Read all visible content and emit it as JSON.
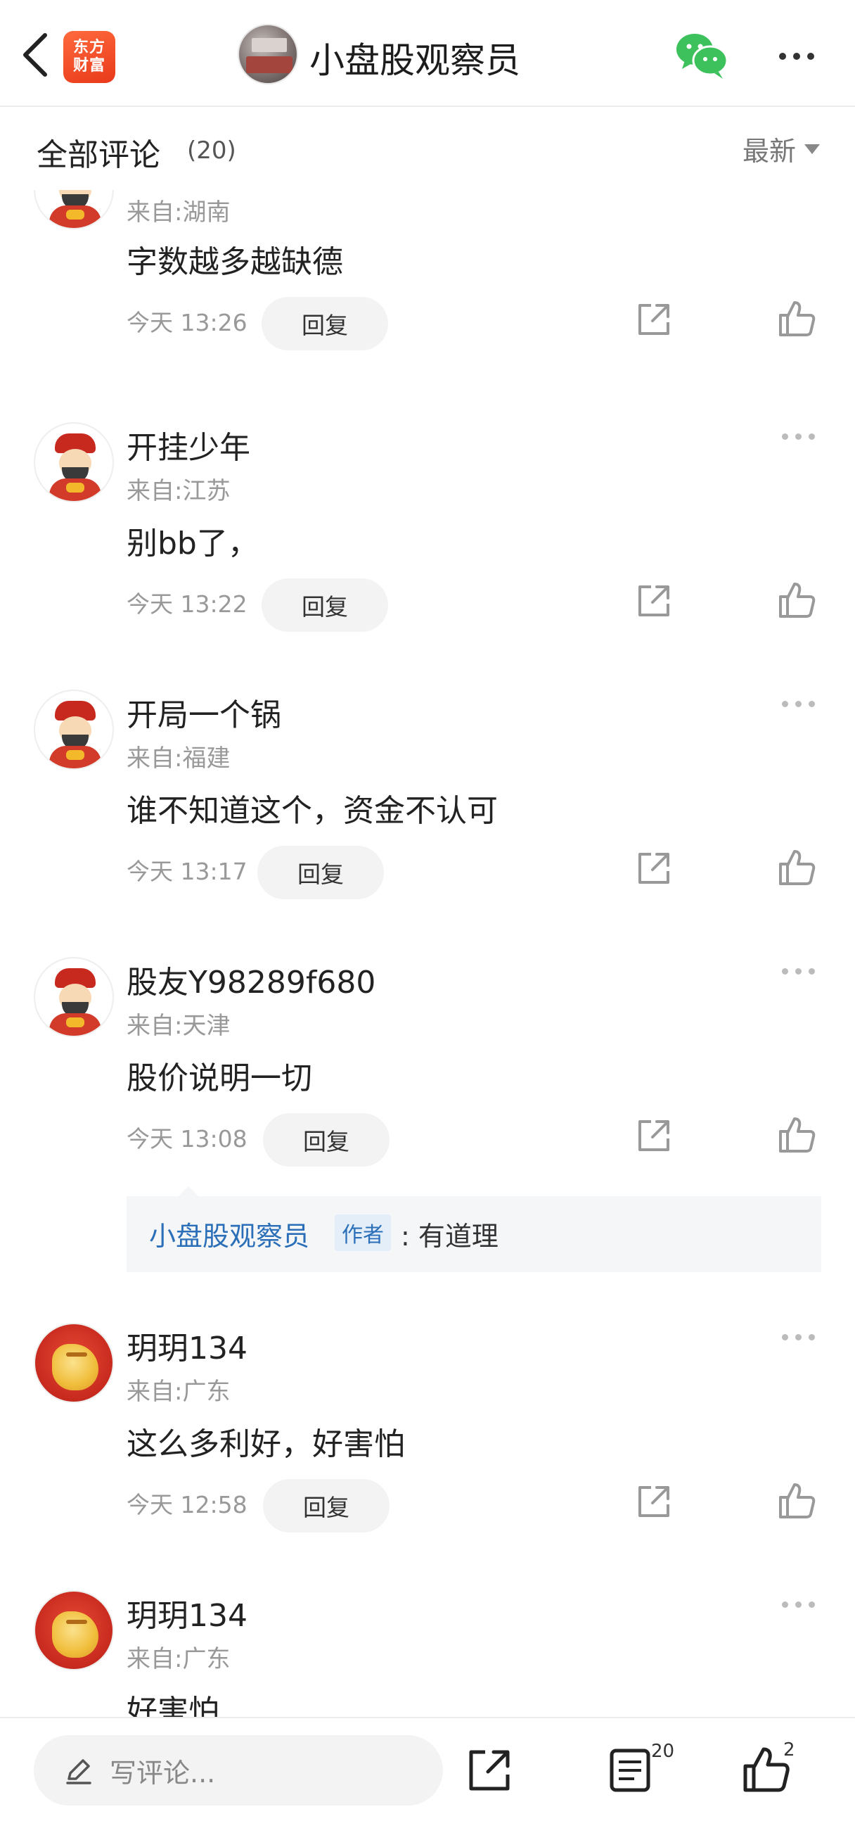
{
  "header": {
    "logo_line1": "东方",
    "logo_line2": "财富",
    "title": "小盘股观察员"
  },
  "section": {
    "title": "全部评论",
    "count": "(20)",
    "sort_label": "最新"
  },
  "comments": [
    {
      "username": "",
      "location": "来自:湖南",
      "content": "字数越多越缺德",
      "time": "今天 13:26",
      "reply_label": "回复",
      "avatar": "caishen"
    },
    {
      "username": "开挂少年",
      "location": "来自:江苏",
      "content": "别bb了，",
      "time": "今天 13:22",
      "reply_label": "回复",
      "avatar": "caishen"
    },
    {
      "username": "开局一个锅",
      "location": "来自:福建",
      "content": "谁不知道这个，资金不认可",
      "time": "今天 13:17",
      "reply_label": "回复",
      "avatar": "caishen"
    },
    {
      "username": "股友Y98289f680",
      "location": "来自:天津",
      "content": "股价说明一切",
      "time": "今天 13:08",
      "reply_label": "回复",
      "avatar": "caishen",
      "author_reply": {
        "name": "小盘股观察员",
        "badge": "作者",
        "text": ": 有道理"
      }
    },
    {
      "username": "玥玥134",
      "location": "来自:广东",
      "content": "这么多利好，好害怕",
      "time": "今天 12:58",
      "reply_label": "回复",
      "avatar": "tiger"
    },
    {
      "username": "玥玥134",
      "location": "来自:广东",
      "content": "好害怕",
      "avatar": "tiger"
    }
  ],
  "bottom": {
    "input_placeholder": "写评论...",
    "comment_count": "20",
    "like_count": "2"
  },
  "colors": {
    "accent": "#e8391a",
    "link_blue": "#2a6fb8",
    "wechat_green": "#3cc15c"
  }
}
